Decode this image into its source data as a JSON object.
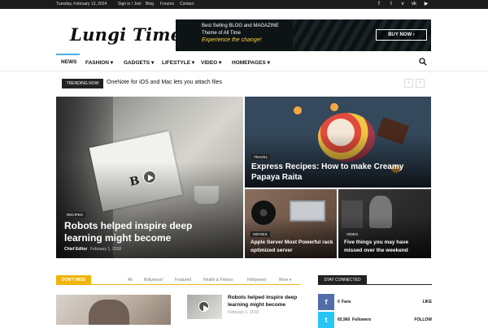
{
  "topbar": {
    "date": "Tuesday, February 13, 2024",
    "links": [
      "Sign in / Join",
      "Blog",
      "Forums",
      "Contact"
    ],
    "social_icons": [
      "facebook-icon",
      "twitter-icon",
      "vimeo-icon",
      "vk-icon",
      "youtube-icon"
    ]
  },
  "header": {
    "logo": "Lungi Times",
    "banner": {
      "line1": "Best Selling BLOG and MAGAZINE",
      "line2": "Theme of All Time",
      "line3": "Experience the change!",
      "button": "BUY NOW ›"
    }
  },
  "nav": {
    "items": [
      "NEWS",
      "FASHION ▾",
      "GADGETS ▾",
      "LIFESTYLE ▾",
      "VIDEO ▾",
      "HOMEPAGES ▾"
    ],
    "active": "NEWS"
  },
  "trending": {
    "label": "TRENDING NOW",
    "headline": "OneNote for iOS and Mac lets you attach files",
    "prev": "‹",
    "next": "›"
  },
  "featured": {
    "main": {
      "category": "RECIPES",
      "title_line1": "Robots helped inspire deep",
      "title_line2": "learning might become",
      "author": "Chief Editor",
      "date": "February 1, 2018"
    },
    "top_right": {
      "category": "TRAVEL",
      "title_line1": "Express Recipes: How to make Creamy",
      "title_line2": "Papaya Raita"
    },
    "bottom_left": {
      "category": "MOVIES",
      "title_line1": "Apple Server Most Powerful rack",
      "title_line2": "optimized server"
    },
    "bottom_right": {
      "category": "VIDEO",
      "title_line1": "Five things you may have",
      "title_line2": "missed over the weekend"
    }
  },
  "dont_miss": {
    "label": "DON'T MISS",
    "tabs": [
      "All",
      "Bollywood",
      "Featured",
      "Health & Fitness",
      "Hollywood",
      "More ▾"
    ],
    "post": {
      "title_line1": "Robots helped inspire deep",
      "title_line2": "learning might become",
      "date": "February 1, 2018"
    }
  },
  "stay_connected": {
    "label": "STAY CONNECTED",
    "rows": [
      {
        "icon": "facebook-icon",
        "glyph": "f",
        "count": "0",
        "unit": "Fans",
        "action": "LIKE",
        "color": "#516eab"
      },
      {
        "icon": "twitter-icon",
        "glyph": "t",
        "count": "65,960",
        "unit": "Followers",
        "action": "FOLLOW",
        "color": "#29c5f6"
      }
    ]
  }
}
